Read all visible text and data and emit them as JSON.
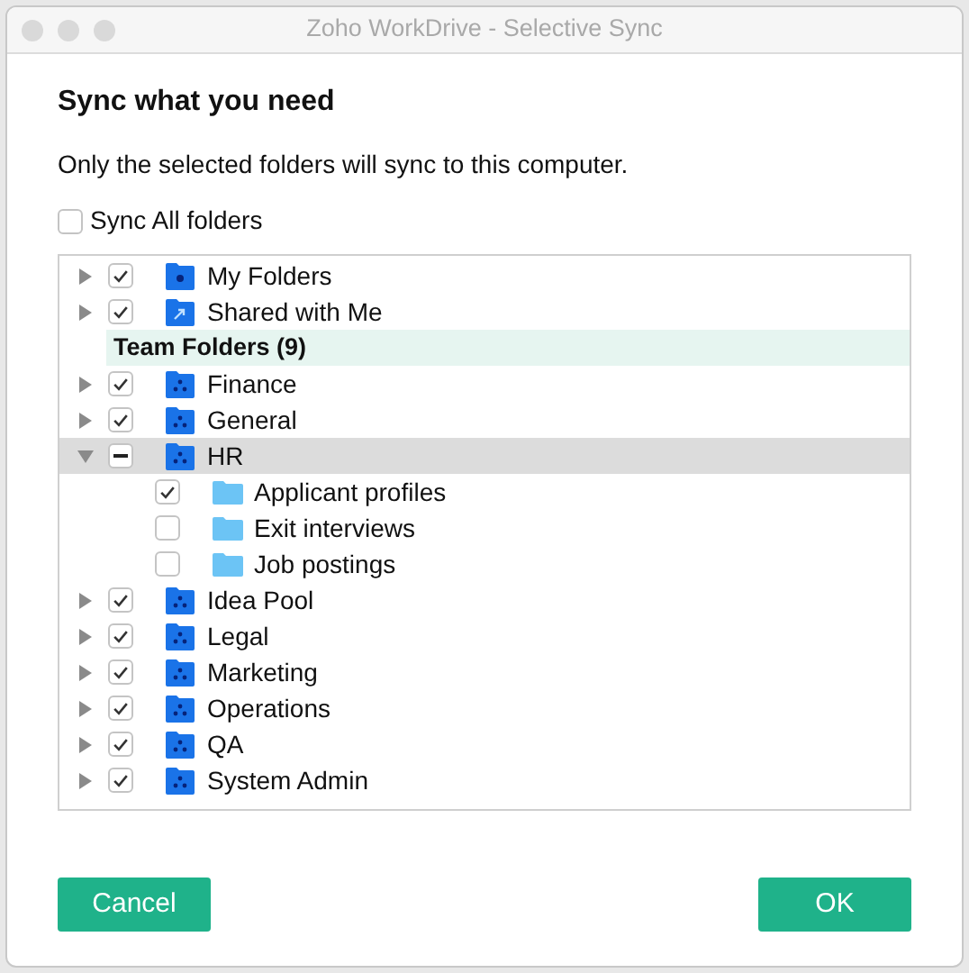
{
  "window": {
    "title": "Zoho WorkDrive - Selective Sync"
  },
  "heading": "Sync what you need",
  "description": "Only the selected folders will sync to this computer.",
  "sync_all": {
    "label": "Sync All folders",
    "checked": false
  },
  "tree": {
    "items": [
      {
        "kind": "personal",
        "label": "My Folders",
        "expanded": false,
        "checked": true,
        "partial": false,
        "selected": false
      },
      {
        "kind": "shared",
        "label": "Shared with Me",
        "expanded": false,
        "checked": true,
        "partial": false,
        "selected": false
      },
      {
        "kind": "header",
        "label": "Team Folders (9)"
      },
      {
        "kind": "team",
        "label": "Finance",
        "expanded": false,
        "checked": true,
        "partial": false,
        "selected": false
      },
      {
        "kind": "team",
        "label": "General",
        "expanded": false,
        "checked": true,
        "partial": false,
        "selected": false
      },
      {
        "kind": "team",
        "label": "HR",
        "expanded": true,
        "checked": false,
        "partial": true,
        "selected": true,
        "children": [
          {
            "kind": "plain",
            "label": "Applicant profiles",
            "checked": true,
            "partial": false,
            "selected": false
          },
          {
            "kind": "plain",
            "label": "Exit interviews",
            "checked": false,
            "partial": false,
            "selected": false
          },
          {
            "kind": "plain",
            "label": "Job postings",
            "checked": false,
            "partial": false,
            "selected": false
          }
        ]
      },
      {
        "kind": "team",
        "label": "Idea Pool",
        "expanded": false,
        "checked": true,
        "partial": false,
        "selected": false
      },
      {
        "kind": "team",
        "label": "Legal",
        "expanded": false,
        "checked": true,
        "partial": false,
        "selected": false
      },
      {
        "kind": "team",
        "label": "Marketing",
        "expanded": false,
        "checked": true,
        "partial": false,
        "selected": false
      },
      {
        "kind": "team",
        "label": "Operations",
        "expanded": false,
        "checked": true,
        "partial": false,
        "selected": false
      },
      {
        "kind": "team",
        "label": "QA",
        "expanded": false,
        "checked": true,
        "partial": false,
        "selected": false
      },
      {
        "kind": "team",
        "label": "System Admin",
        "expanded": false,
        "checked": true,
        "partial": false,
        "selected": false
      }
    ]
  },
  "buttons": {
    "cancel": "Cancel",
    "ok": "OK"
  }
}
